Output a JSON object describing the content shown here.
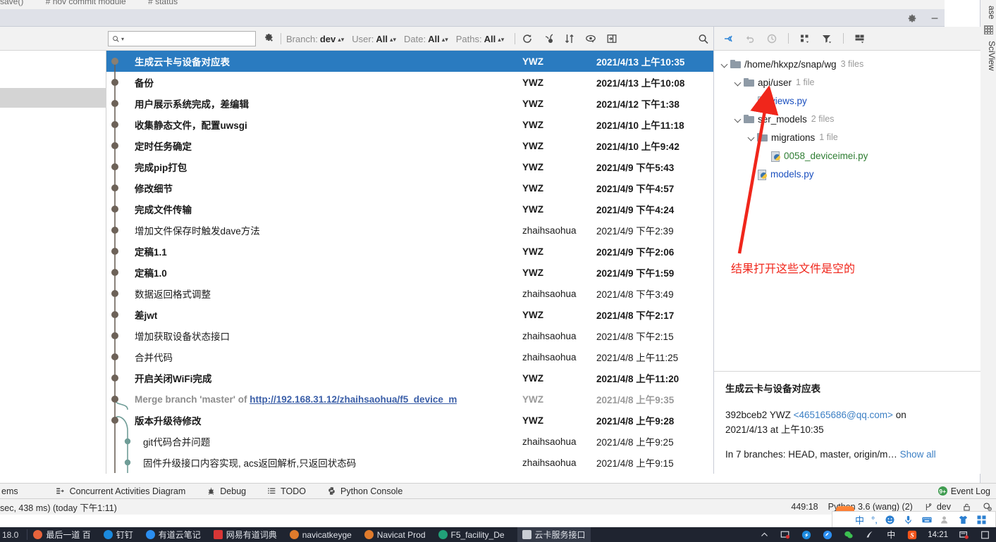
{
  "editor": {
    "breadcrumbs": [
      "save()",
      "# nov commit module",
      "# status"
    ]
  },
  "right_edge": {
    "db_tab": "ase",
    "sciview_tab": "SciView",
    "sciview_icon": "grid-icon"
  },
  "window_buttons": {
    "settings": "gear-icon",
    "minimize": "minimize-icon",
    "expand_all": "expand-all-icon",
    "collapse_all": "collapse-all-icon"
  },
  "log_toolbar": {
    "search_placeholder": "",
    "search_icon": "search-icon",
    "search_caret": "chevron-down-icon",
    "gear_icon": "gear-dropdown-icon",
    "filters": [
      {
        "label": "Branch:",
        "value": "dev"
      },
      {
        "label": "User:",
        "value": "All"
      },
      {
        "label": "Date:",
        "value": "All"
      },
      {
        "label": "Paths:",
        "value": "All"
      }
    ],
    "icons": [
      "refresh-icon",
      "cherry-pick-icon",
      "intellisort-icon",
      "show-details-icon",
      "open-in-new-window-icon"
    ],
    "right_search_icon": "search-icon"
  },
  "commits": {
    "rows": [
      {
        "subject": "生成云卡与设备对应表",
        "author": "YWZ",
        "date": "2021/4/13 上午10:35",
        "style": "selected",
        "graph": "node"
      },
      {
        "subject": "备份",
        "author": "YWZ",
        "date": "2021/4/13 上午10:08",
        "style": "bold",
        "graph": "node"
      },
      {
        "subject": "用户展示系统完成，差编辑",
        "author": "YWZ",
        "date": "2021/4/12 下午1:38",
        "style": "bold",
        "graph": "node"
      },
      {
        "subject": "收集静态文件，配置uwsgi",
        "author": "YWZ",
        "date": "2021/4/10 上午11:18",
        "style": "bold",
        "graph": "node"
      },
      {
        "subject": "定时任务确定",
        "author": "YWZ",
        "date": "2021/4/10 上午9:42",
        "style": "bold",
        "graph": "node"
      },
      {
        "subject": "完成pip打包",
        "author": "YWZ",
        "date": "2021/4/9 下午5:43",
        "style": "bold",
        "graph": "node"
      },
      {
        "subject": "修改细节",
        "author": "YWZ",
        "date": "2021/4/9 下午4:57",
        "style": "bold",
        "graph": "node"
      },
      {
        "subject": "完成文件传输",
        "author": "YWZ",
        "date": "2021/4/9 下午4:24",
        "style": "bold",
        "graph": "node"
      },
      {
        "subject": "增加文件保存时触发dave方法",
        "author": "zhaihsaohua",
        "date": "2021/4/9 下午2:39",
        "style": "normal",
        "graph": "node"
      },
      {
        "subject": "定稿1.1",
        "author": "YWZ",
        "date": "2021/4/9 下午2:06",
        "style": "bold",
        "graph": "node"
      },
      {
        "subject": "定稿1.0",
        "author": "YWZ",
        "date": "2021/4/9 下午1:59",
        "style": "bold",
        "graph": "node"
      },
      {
        "subject": "数据返回格式调整",
        "author": "zhaihsaohua",
        "date": "2021/4/8 下午3:49",
        "style": "normal",
        "graph": "node"
      },
      {
        "subject": "差jwt",
        "author": "YWZ",
        "date": "2021/4/8 下午2:17",
        "style": "bold",
        "graph": "node"
      },
      {
        "subject": "增加获取设备状态接口",
        "author": "zhaihsaohua",
        "date": "2021/4/8 下午2:15",
        "style": "normal",
        "graph": "node"
      },
      {
        "subject": "合并代码",
        "author": "zhaihsaohua",
        "date": "2021/4/8 上午11:25",
        "style": "normal",
        "graph": "node"
      },
      {
        "subject": "开启关闭WiFi完成",
        "author": "YWZ",
        "date": "2021/4/8 上午11:20",
        "style": "bold",
        "graph": "node"
      },
      {
        "subject": "Merge branch 'master' of ",
        "link": "http://192.168.31.12/zhaihsaohua/f5_device_m",
        "author": "YWZ",
        "date": "2021/4/8 上午9:35",
        "style": "muted",
        "graph": "merge"
      },
      {
        "subject": "版本升级待修改",
        "author": "YWZ",
        "date": "2021/4/8 上午9:28",
        "style": "bold",
        "graph": "fork"
      },
      {
        "subject": "git代码合并问题",
        "author": "zhaihsaohua",
        "date": "2021/4/8 上午9:25",
        "style": "normal",
        "graph": "branch"
      },
      {
        "subject": "固件升级接口内容实现, acs返回解析,只返回状态码",
        "author": "zhaihsaohua",
        "date": "2021/4/8 上午9:15",
        "style": "normal",
        "graph": "branch"
      }
    ]
  },
  "changed_files": {
    "toolbar_icons": [
      "group-by-icon",
      "undo-icon",
      "history-icon",
      "expand-tree-icon",
      "filter-icon",
      "layout-icon"
    ],
    "tree": [
      {
        "indent": 0,
        "type": "folder",
        "name": "/home/hkxpz/snap/wg",
        "count": "3 files",
        "expanded": true
      },
      {
        "indent": 1,
        "type": "folder",
        "name": "api/user",
        "count": "1 file",
        "expanded": true
      },
      {
        "indent": 2,
        "type": "file",
        "name": "views.py",
        "color": "blue"
      },
      {
        "indent": 1,
        "type": "folder",
        "name": "ser_models",
        "count": "2 files",
        "expanded": true
      },
      {
        "indent": 2,
        "type": "folder",
        "name": "migrations",
        "count": "1 file",
        "expanded": true
      },
      {
        "indent": 3,
        "type": "file",
        "name": "0058_deviceimei.py",
        "color": "green"
      },
      {
        "indent": 2,
        "type": "file",
        "name": "models.py",
        "color": "blue"
      }
    ],
    "annotation": {
      "text": "结果打开这些文件是空的",
      "color": "#f0261b",
      "arrow": "red-arrow-pointing-to-views-py"
    }
  },
  "commit_details": {
    "title": "生成云卡与设备对应表",
    "hash": "392bceb2",
    "author": "YWZ",
    "email": "<465165686@qq.com>",
    "on_word": "on",
    "date_line": "2021/4/13 at 上午10:35",
    "branches_prefix": "In 7 branches: HEAD, master, origin/m",
    "branches_ellipsis": "…",
    "show_all": "Show all"
  },
  "tool_windows": {
    "items": [
      {
        "label": "ems",
        "icon": ""
      },
      {
        "label": "Concurrent Activities Diagram",
        "icon": "diagram-icon"
      },
      {
        "label": "Debug",
        "icon": "bug-icon"
      },
      {
        "label": "TODO",
        "icon": "list-icon"
      },
      {
        "label": "Python Console",
        "icon": "python-icon"
      }
    ],
    "event_log": {
      "label": "Event Log",
      "badge": "9+"
    }
  },
  "status_bar": {
    "left": "sec, 438 ms) (today 下午1:11)",
    "caret": "449:18",
    "interpreter": "Python 3.6 (wang) (2)",
    "branch_icon": "git-branch-icon",
    "branch": "dev",
    "lock_icon": "lock-icon",
    "inspect_icon": "inspection-icon"
  },
  "ime_bar": {
    "logo": "S",
    "items": [
      "中",
      "°,",
      "smiley-icon",
      "mic-icon",
      "keyboard-icon",
      "user-icon",
      "skin-icon",
      "apps-icon"
    ]
  },
  "taskbar": {
    "left_label": "18.0",
    "items": [
      {
        "label": "最后一道 百",
        "icon": "chrome-icon",
        "color": "#e8643c",
        "active": false
      },
      {
        "label": "钉钉",
        "icon": "dingtalk-icon",
        "color": "#1b8ade",
        "active": false
      },
      {
        "label": "有道云笔记",
        "icon": "youdao-note-icon",
        "color": "#2b8ef0",
        "active": false
      },
      {
        "label": "网易有道词典",
        "icon": "youdao-dict-icon",
        "color": "#d83636",
        "active": false
      },
      {
        "label": "navicatkeyge",
        "icon": "navicat-icon",
        "color": "#e07b2c",
        "active": false
      },
      {
        "label": "Navicat Prod",
        "icon": "navicat-icon",
        "color": "#e07b2c",
        "active": false
      },
      {
        "label": "F5_facility_De",
        "icon": "pycharm-icon",
        "color": "#21a179",
        "active": false
      },
      {
        "label": "云卡服务接口",
        "icon": "typora-icon",
        "color": "#c9cdd4",
        "active": true
      }
    ],
    "tray": {
      "icons": [
        "chevron-up-icon",
        "display-icon",
        "dingtalk-icon",
        "youdao-icon",
        "wechat-icon",
        "onenote-icon",
        "ime-cn-icon",
        "sogou-icon"
      ],
      "clock": "14:21",
      "notify_icon": "notification-icon",
      "show-desktop": "show-desktop-icon"
    }
  }
}
